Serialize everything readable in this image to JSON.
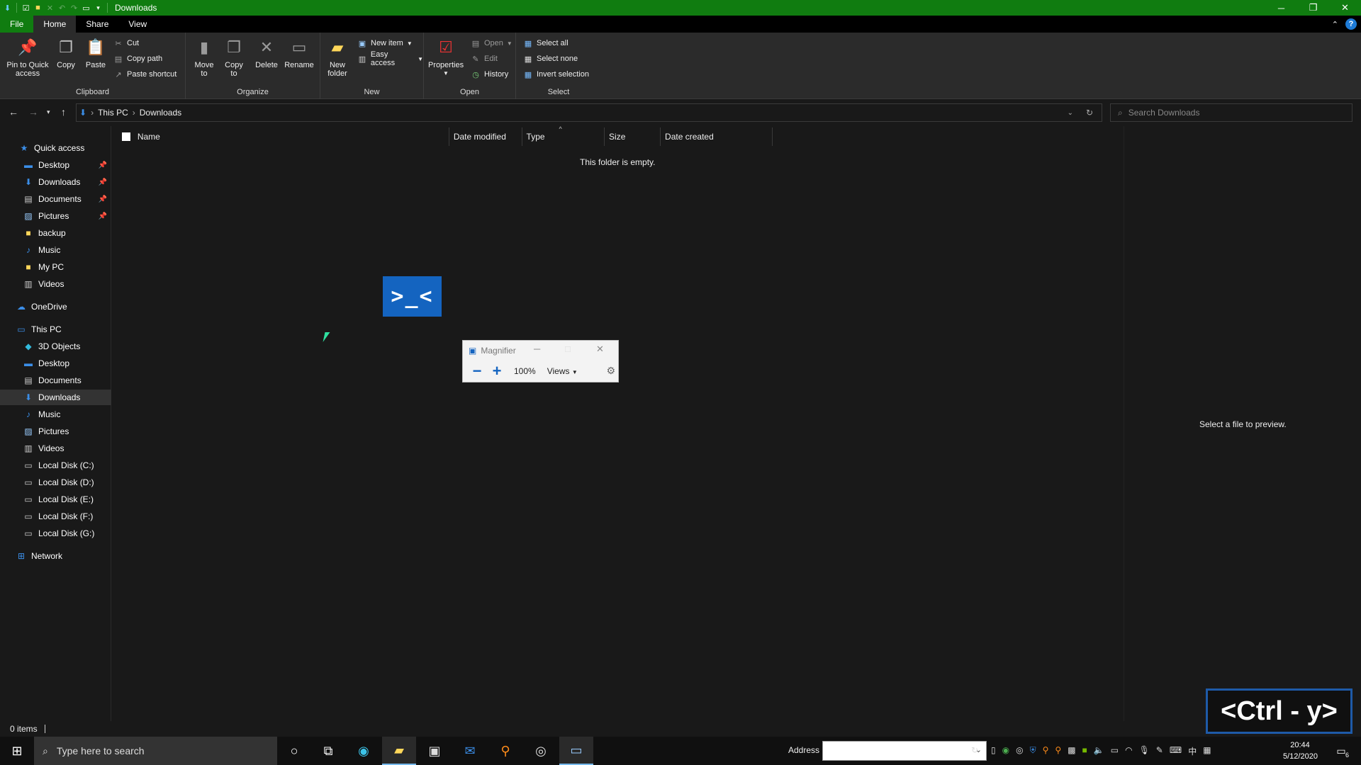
{
  "window": {
    "title": "Downloads"
  },
  "colors": {
    "accent": "#107c10",
    "selection": "#333333",
    "blue": "#1464c0"
  },
  "tabs": [
    {
      "label": "File"
    },
    {
      "label": "Home"
    },
    {
      "label": "Share"
    },
    {
      "label": "View"
    }
  ],
  "ribbon": {
    "clipboard": {
      "label": "Clipboard",
      "pin": "Pin to Quick",
      "pin2": "access",
      "copy": "Copy",
      "paste": "Paste",
      "cut": "Cut",
      "copy_path": "Copy path",
      "paste_shortcut": "Paste shortcut"
    },
    "organize": {
      "label": "Organize",
      "move1": "Move",
      "move2": "to",
      "copy1": "Copy",
      "copy2": "to",
      "delete": "Delete",
      "rename": "Rename"
    },
    "new": {
      "label": "New",
      "new_folder1": "New",
      "new_folder2": "folder",
      "new_item": "New item",
      "easy_access": "Easy access"
    },
    "open": {
      "label": "Open",
      "properties": "Properties",
      "open": "Open",
      "edit": "Edit",
      "history": "History"
    },
    "select": {
      "label": "Select",
      "select_all": "Select all",
      "select_none": "Select none",
      "invert": "Invert selection"
    }
  },
  "address": {
    "crumbs": [
      "This PC",
      "Downloads"
    ],
    "search_placeholder": "Search Downloads"
  },
  "nav": {
    "quick_access": "Quick access",
    "quick_items": [
      "Desktop",
      "Downloads",
      "Documents",
      "Pictures",
      "backup",
      "Music",
      "My PC",
      "Videos"
    ],
    "onedrive": "OneDrive",
    "this_pc": "This PC",
    "pc_items": [
      "3D Objects",
      "Desktop",
      "Documents",
      "Downloads",
      "Music",
      "Pictures",
      "Videos",
      "Local Disk (C:)",
      "Local Disk (D:)",
      "Local Disk (E:)",
      "Local Disk (F:)",
      "Local Disk (G:)"
    ],
    "network": "Network"
  },
  "columns": [
    "Name",
    "Date modified",
    "Type",
    "Size",
    "Date created"
  ],
  "content": {
    "empty_message": "This folder is empty.",
    "preview_message": "Select a file to preview."
  },
  "terminal_icon": {
    "glyph": ">_<"
  },
  "magnifier": {
    "title": "Magnifier",
    "zoom": "100%",
    "views": "Views"
  },
  "status": {
    "items": "0 items"
  },
  "keystroke": {
    "text": "<Ctrl - y>"
  },
  "taskbar": {
    "search_placeholder": "Type here to search",
    "address_label": "Address",
    "time": "20:44",
    "date": "5/12/2020",
    "ime": "中",
    "notification_count": "6"
  }
}
